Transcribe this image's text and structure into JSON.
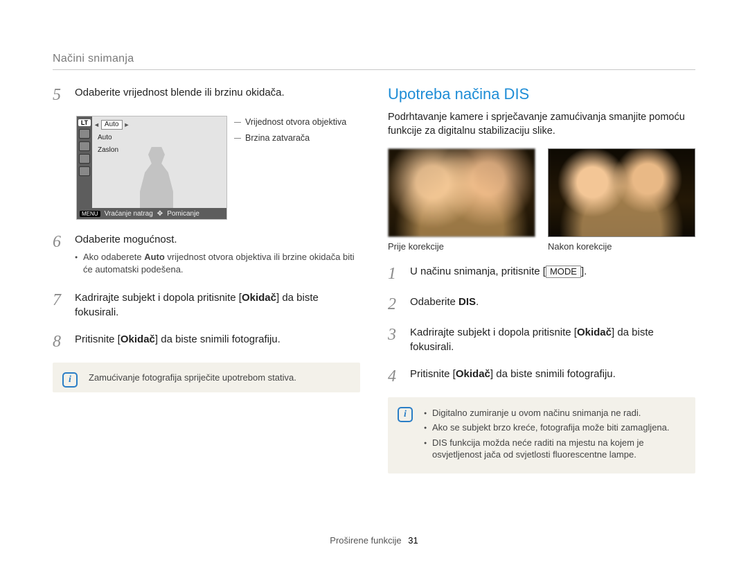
{
  "breadcrumb": "Načini snimanja",
  "left": {
    "step5": {
      "num": "5",
      "text": "Odaberite vrijednost blende ili brzinu okidača."
    },
    "lcd": {
      "lt": "LT",
      "auto1": "Auto",
      "auto2": "Auto",
      "zaslon": "Zaslon",
      "menu": "MENU",
      "back": "Vraćanje natrag",
      "move": "Pomicanje",
      "annot1": "Vrijednost otvora objektiva",
      "annot2": "Brzina zatvarača"
    },
    "step6": {
      "num": "6",
      "text": "Odaberite mogućnost.",
      "bullet_pre": "Ako odaberete ",
      "bullet_bold": "Auto",
      "bullet_post": " vrijednost otvora objektiva ili brzine okidača biti će automatski podešena."
    },
    "step7": {
      "num": "7",
      "pre": "Kadrirajte subjekt i dopola pritisnite [",
      "bold": "Okidač",
      "post": "] da biste fokusirali."
    },
    "step8": {
      "num": "8",
      "pre": "Pritisnite [",
      "bold": "Okidač",
      "post": "] da biste snimili fotograﬁju."
    },
    "info": "Zamućivanje fotograﬁja spriječite upotrebom stativa."
  },
  "right": {
    "heading": "Upotreba načina DIS",
    "intro": "Podrhtavanje kamere i sprječavanje zamućivanja smanjite pomoću funkcije za digitalnu stabilizaciju slike.",
    "cap_before": "Prije korekcije",
    "cap_after": "Nakon korekcije",
    "step1": {
      "num": "1",
      "pre": "U načinu snimanja, pritisnite [",
      "kbd": "MODE",
      "post": "]."
    },
    "step2": {
      "num": "2",
      "pre": "Odaberite ",
      "bold": "DIS",
      "post": "."
    },
    "step3": {
      "num": "3",
      "pre": "Kadrirajte subjekt i dopola pritisnite [",
      "bold": "Okidač",
      "post": "] da biste fokusirali."
    },
    "step4": {
      "num": "4",
      "pre": "Pritisnite [",
      "bold": "Okidač",
      "post": "] da biste snimili fotograﬁju."
    },
    "info_bullets": [
      "Digitalno zumiranje u ovom načinu snimanja ne radi.",
      "Ako se subjekt brzo kreće, fotograﬁja može biti zamagljena.",
      "DIS funkcija možda neće raditi na mjestu na kojem je osvjetljenost jača od svjetlosti ﬂuorescentne lampe."
    ]
  },
  "footer": {
    "label": "Proširene funkcije",
    "page": "31"
  }
}
